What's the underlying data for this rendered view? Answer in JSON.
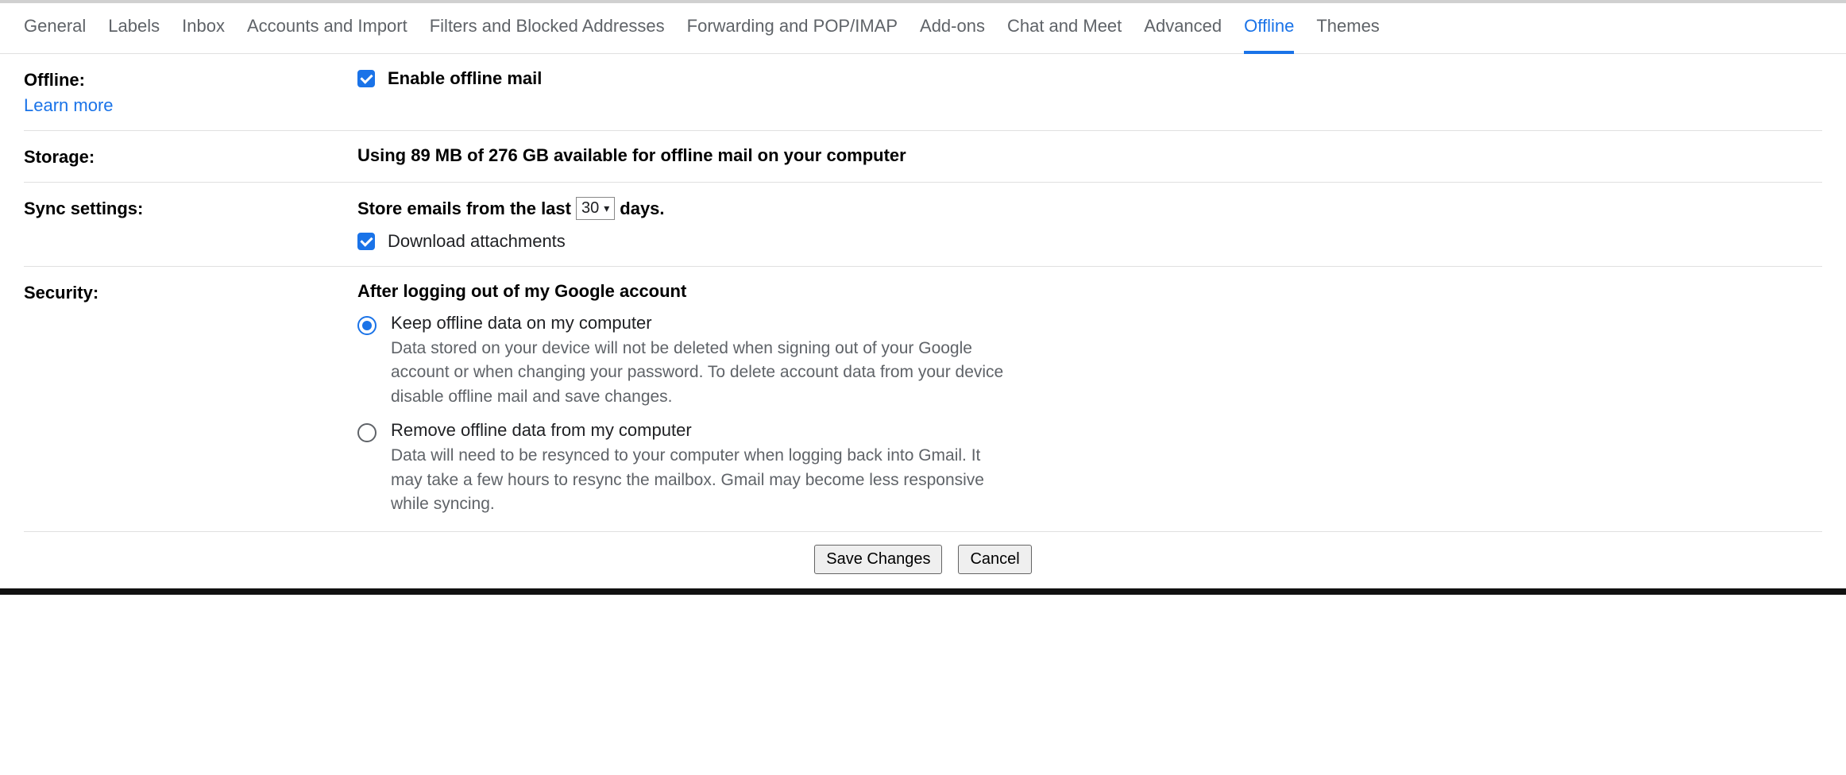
{
  "tabs": [
    "General",
    "Labels",
    "Inbox",
    "Accounts and Import",
    "Filters and Blocked Addresses",
    "Forwarding and POP/IMAP",
    "Add-ons",
    "Chat and Meet",
    "Advanced",
    "Offline",
    "Themes"
  ],
  "active_tab_index": 9,
  "offline": {
    "label": "Offline:",
    "learn_more": "Learn more",
    "enable_label": "Enable offline mail",
    "enable_checked": true
  },
  "storage": {
    "label": "Storage:",
    "text": "Using 89 MB of 276 GB available for offline mail on your computer"
  },
  "sync": {
    "label": "Sync settings:",
    "store_prefix": "Store emails from the last",
    "store_days_value": "30",
    "store_suffix": "days.",
    "download_label": "Download attachments",
    "download_checked": true
  },
  "security": {
    "label": "Security:",
    "heading": "After logging out of my Google account",
    "options": [
      {
        "title": "Keep offline data on my computer",
        "desc": "Data stored on your device will not be deleted when signing out of your Google account or when changing your password. To delete account data from your device disable offline mail and save changes.",
        "selected": true
      },
      {
        "title": "Remove offline data from my computer",
        "desc": "Data will need to be resynced to your computer when logging back into Gmail. It may take a few hours to resync the mailbox. Gmail may become less responsive while syncing.",
        "selected": false
      }
    ]
  },
  "footer": {
    "save": "Save Changes",
    "cancel": "Cancel"
  }
}
